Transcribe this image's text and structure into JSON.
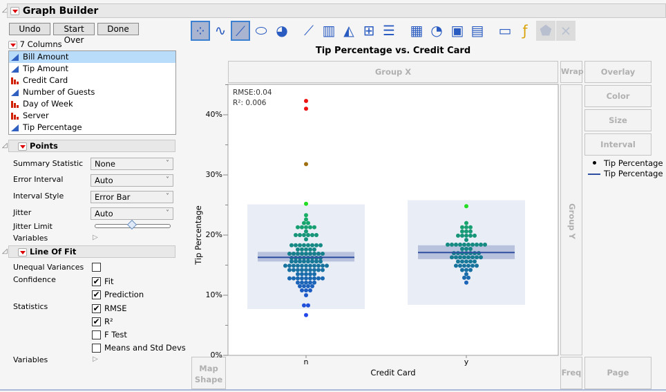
{
  "window": {
    "title": "Graph Builder"
  },
  "buttons": {
    "undo": "Undo",
    "start_over": "Start Over",
    "done": "Done"
  },
  "columns": {
    "header": "7 Columns",
    "items": [
      {
        "label": "Bill Amount",
        "type": "continuous",
        "selected": true
      },
      {
        "label": "Tip Amount",
        "type": "continuous"
      },
      {
        "label": "Credit Card",
        "type": "nominal"
      },
      {
        "label": "Number of Guests",
        "type": "continuous"
      },
      {
        "label": "Day of Week",
        "type": "nominal"
      },
      {
        "label": "Server",
        "type": "nominal"
      },
      {
        "label": "Tip Percentage",
        "type": "continuous"
      }
    ]
  },
  "points": {
    "header": "Points",
    "summary_statistic": {
      "label": "Summary Statistic",
      "value": "None"
    },
    "error_interval": {
      "label": "Error Interval",
      "value": "Auto"
    },
    "interval_style": {
      "label": "Interval Style",
      "value": "Error Bar"
    },
    "jitter": {
      "label": "Jitter",
      "value": "Auto"
    },
    "jitter_limit": {
      "label": "Jitter Limit",
      "value": 0.5
    },
    "variables": "Variables"
  },
  "line_of_fit": {
    "header": "Line Of Fit",
    "unequal_variances": {
      "label": "Unequal Variances",
      "checked": false
    },
    "confidence_label": "Confidence",
    "fit": {
      "label": "Fit",
      "checked": true
    },
    "prediction": {
      "label": "Prediction",
      "checked": true
    },
    "statistics_label": "Statistics",
    "rmse": {
      "label": "RMSE",
      "checked": true
    },
    "r2": {
      "label": "R²",
      "checked": true
    },
    "f_test": {
      "label": "F Test",
      "checked": false
    },
    "means_std": {
      "label": "Means and Std Devs",
      "checked": false
    },
    "variables": "Variables"
  },
  "toolbar": {
    "icons": [
      "points",
      "smoother",
      "line-of-fit",
      "ellipse",
      "contour",
      "line",
      "bar",
      "area",
      "box-plot",
      "histogram",
      "heatmap",
      "pie",
      "treemap",
      "mosaic",
      "caption-box",
      "formula",
      "map-shapes",
      "parallel"
    ],
    "active": [
      "points",
      "line-of-fit"
    ]
  },
  "zones": {
    "group_x": "Group X",
    "wrap": "Wrap",
    "overlay": "Overlay",
    "color": "Color",
    "size": "Size",
    "interval": "Interval",
    "group_y": "Group Y",
    "map_shape": "Map Shape",
    "freq": "Freq",
    "page": "Page"
  },
  "legend": {
    "items": [
      "Tip Percentage",
      "Tip Percentage"
    ],
    "line_color": "#2e4fa0"
  },
  "chart_data": {
    "type": "scatter",
    "title": "Tip Percentage vs. Credit Card",
    "xlabel": "Credit Card",
    "ylabel": "Tip Percentage",
    "categories": [
      "n",
      "y"
    ],
    "ylim": [
      0,
      45
    ],
    "yticks": [
      "0%",
      "10%",
      "20%",
      "30%",
      "40%"
    ],
    "annotations": {
      "rmse": "RMSE:0.04",
      "r2": "R²: 0.006"
    },
    "groups": [
      {
        "category": "n",
        "mean": 16.3,
        "ci": [
          15.6,
          17.2
        ],
        "prediction": [
          7.7,
          25.1
        ],
        "rows": [
          [
            42.3,
            1
          ],
          [
            41.0,
            1
          ],
          [
            31.8,
            1
          ],
          [
            25.2,
            1
          ],
          [
            23.3,
            1
          ],
          [
            22.6,
            1
          ],
          [
            22.0,
            2
          ],
          [
            21.3,
            5
          ],
          [
            20.6,
            1
          ],
          [
            20.0,
            6
          ],
          [
            19.3,
            1
          ],
          [
            18.3,
            8
          ],
          [
            17.6,
            5
          ],
          [
            16.9,
            9
          ],
          [
            16.2,
            8
          ],
          [
            15.6,
            8
          ],
          [
            14.9,
            11
          ],
          [
            14.2,
            9
          ],
          [
            13.5,
            5
          ],
          [
            12.8,
            9
          ],
          [
            12.1,
            5
          ],
          [
            11.5,
            4
          ],
          [
            10.8,
            3
          ],
          [
            10.0,
            1
          ],
          [
            8.3,
            2
          ],
          [
            6.7,
            1
          ]
        ]
      },
      {
        "category": "y",
        "mean": 17.1,
        "ci": [
          16.0,
          18.3
        ],
        "prediction": [
          8.4,
          25.8
        ],
        "rows": [
          [
            24.8,
            1
          ],
          [
            22.0,
            1
          ],
          [
            21.3,
            3
          ],
          [
            20.6,
            3
          ],
          [
            19.9,
            5
          ],
          [
            19.2,
            1
          ],
          [
            18.4,
            10
          ],
          [
            17.7,
            3
          ],
          [
            17.0,
            7
          ],
          [
            16.3,
            8
          ],
          [
            15.6,
            5
          ],
          [
            14.9,
            6
          ],
          [
            14.2,
            3
          ],
          [
            13.5,
            1
          ],
          [
            12.9,
            2
          ],
          [
            12.1,
            1
          ]
        ]
      }
    ],
    "colors": {
      "fit_line": "#2e4fa0",
      "ci_band": "#b8c2dc",
      "prediction_band": "#e9edf5"
    }
  }
}
